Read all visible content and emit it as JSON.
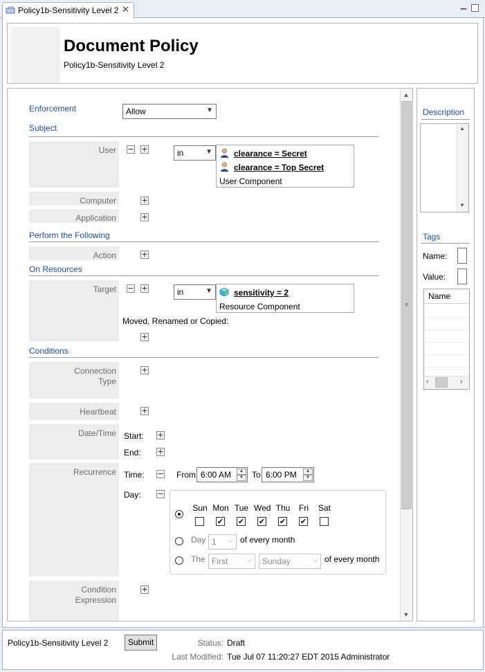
{
  "tab": {
    "label": "Policy1b-Sensitivity Level 2",
    "close": "✕"
  },
  "window_controls": {
    "minimize": "▁",
    "maximize": ""
  },
  "header": {
    "title": "Document Policy",
    "subtitle": "Policy1b-Sensitivity Level 2"
  },
  "enforcement": {
    "label": "Enforcement",
    "value": "Allow"
  },
  "subject": {
    "section_title": "Subject",
    "user": {
      "label": "User",
      "operator": "in",
      "components": [
        "clearance = Secret",
        "clearance = Top Secret"
      ],
      "component_type": "User Component"
    },
    "computer_label": "Computer",
    "application_label": "Application"
  },
  "perform": {
    "section_title": "Perform the Following",
    "action_label": "Action"
  },
  "resources": {
    "section_title": "On Resources",
    "target": {
      "label": "Target",
      "operator": "in",
      "components": [
        "sensitivity = 2"
      ],
      "component_type": "Resource Component"
    },
    "moved_label": "Moved, Renamed or Copied:"
  },
  "conditions": {
    "section_title": "Conditions",
    "connection_type_label_1": "Connection",
    "connection_type_label_2": "Type",
    "heartbeat_label": "Heartbeat",
    "datetime": {
      "label": "Date/Time",
      "start_label": "Start:",
      "end_label": "End:"
    },
    "recurrence": {
      "label": "Recurrence",
      "time_label": "Time:",
      "from_label": "From",
      "from_value": "6:00 AM",
      "to_label": "To",
      "to_value": "6:00 PM",
      "day_label": "Day:",
      "days": [
        {
          "name": "Sun",
          "checked": false
        },
        {
          "name": "Mon",
          "checked": true
        },
        {
          "name": "Tue",
          "checked": true
        },
        {
          "name": "Wed",
          "checked": true
        },
        {
          "name": "Thu",
          "checked": true
        },
        {
          "name": "Fri",
          "checked": true
        },
        {
          "name": "Sat",
          "checked": false
        }
      ],
      "day_of_month": {
        "label": "Day",
        "value": "1",
        "suffix": "of every month"
      },
      "the_option": {
        "label": "The",
        "ordinal": "First",
        "weekday": "Sunday",
        "suffix": "of every month"
      },
      "selected_mode": "weekdays"
    },
    "expression_label_1": "Condition",
    "expression_label_2": "Expression"
  },
  "side": {
    "description_title": "Description",
    "tags_title": "Tags",
    "name_label": "Name:",
    "value_label": "Value:",
    "table_header": "Name"
  },
  "footer": {
    "policy_name": "Policy1b-Sensitivity Level 2",
    "submit_label": "Submit",
    "status_label": "Status:",
    "status_value": "Draft",
    "modified_label": "Last Modified:",
    "modified_value": "Tue Jul 07 11:20:27 EDT 2015 Administrator"
  },
  "buttons": {
    "add": "+",
    "remove": "−"
  },
  "icons": {
    "user_component": "user-icon",
    "resource_component": "resource-cube-icon"
  },
  "colors": {
    "section_title": "#1f4e9a",
    "label_bg": "#ececec"
  }
}
